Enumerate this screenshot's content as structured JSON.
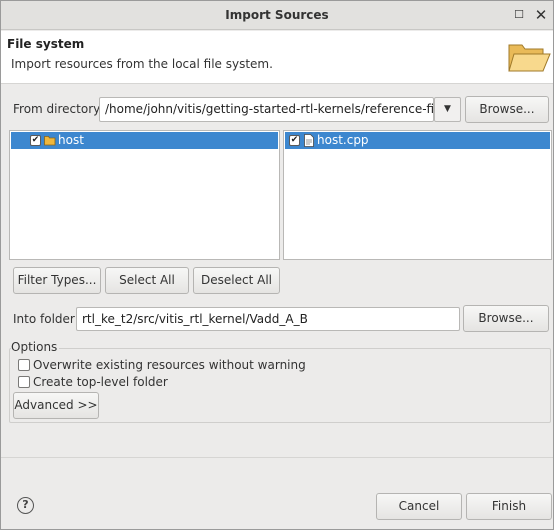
{
  "window": {
    "title": "Import Sources",
    "maximize_glyph": "☐",
    "close_glyph": "✕"
  },
  "header": {
    "title": "File system",
    "description": "Import resources from the local file system.",
    "icon": "folder-open-icon"
  },
  "from_directory": {
    "label": "From directory:",
    "value": "/home/john/vitis/getting-started-rtl-kernels/reference-files/s",
    "dropdown_glyph": "▼",
    "browse_label": "Browse..."
  },
  "left_tree": {
    "items": [
      {
        "label": "host",
        "checked": true,
        "selected": true,
        "icon": "folder-icon"
      }
    ]
  },
  "right_list": {
    "items": [
      {
        "label": "host.cpp",
        "checked": true,
        "selected": true,
        "icon": "file-icon"
      }
    ]
  },
  "selection_buttons": {
    "filter_types": "Filter Types...",
    "select_all": "Select All",
    "deselect_all": "Deselect All"
  },
  "into_folder": {
    "label": "Into folder:",
    "value": "rtl_ke_t2/src/vitis_rtl_kernel/Vadd_A_B",
    "browse_label": "Browse..."
  },
  "options": {
    "label": "Options",
    "overwrite": {
      "label": "Overwrite existing resources without warning",
      "checked": false
    },
    "top_level": {
      "label": "Create top-level folder",
      "checked": false
    },
    "advanced_label": "Advanced >>"
  },
  "footer": {
    "help_glyph": "?",
    "cancel_label": "Cancel",
    "finish_label": "Finish"
  },
  "colors": {
    "selection": "#3d87cf",
    "folder": "#f0b73c"
  }
}
